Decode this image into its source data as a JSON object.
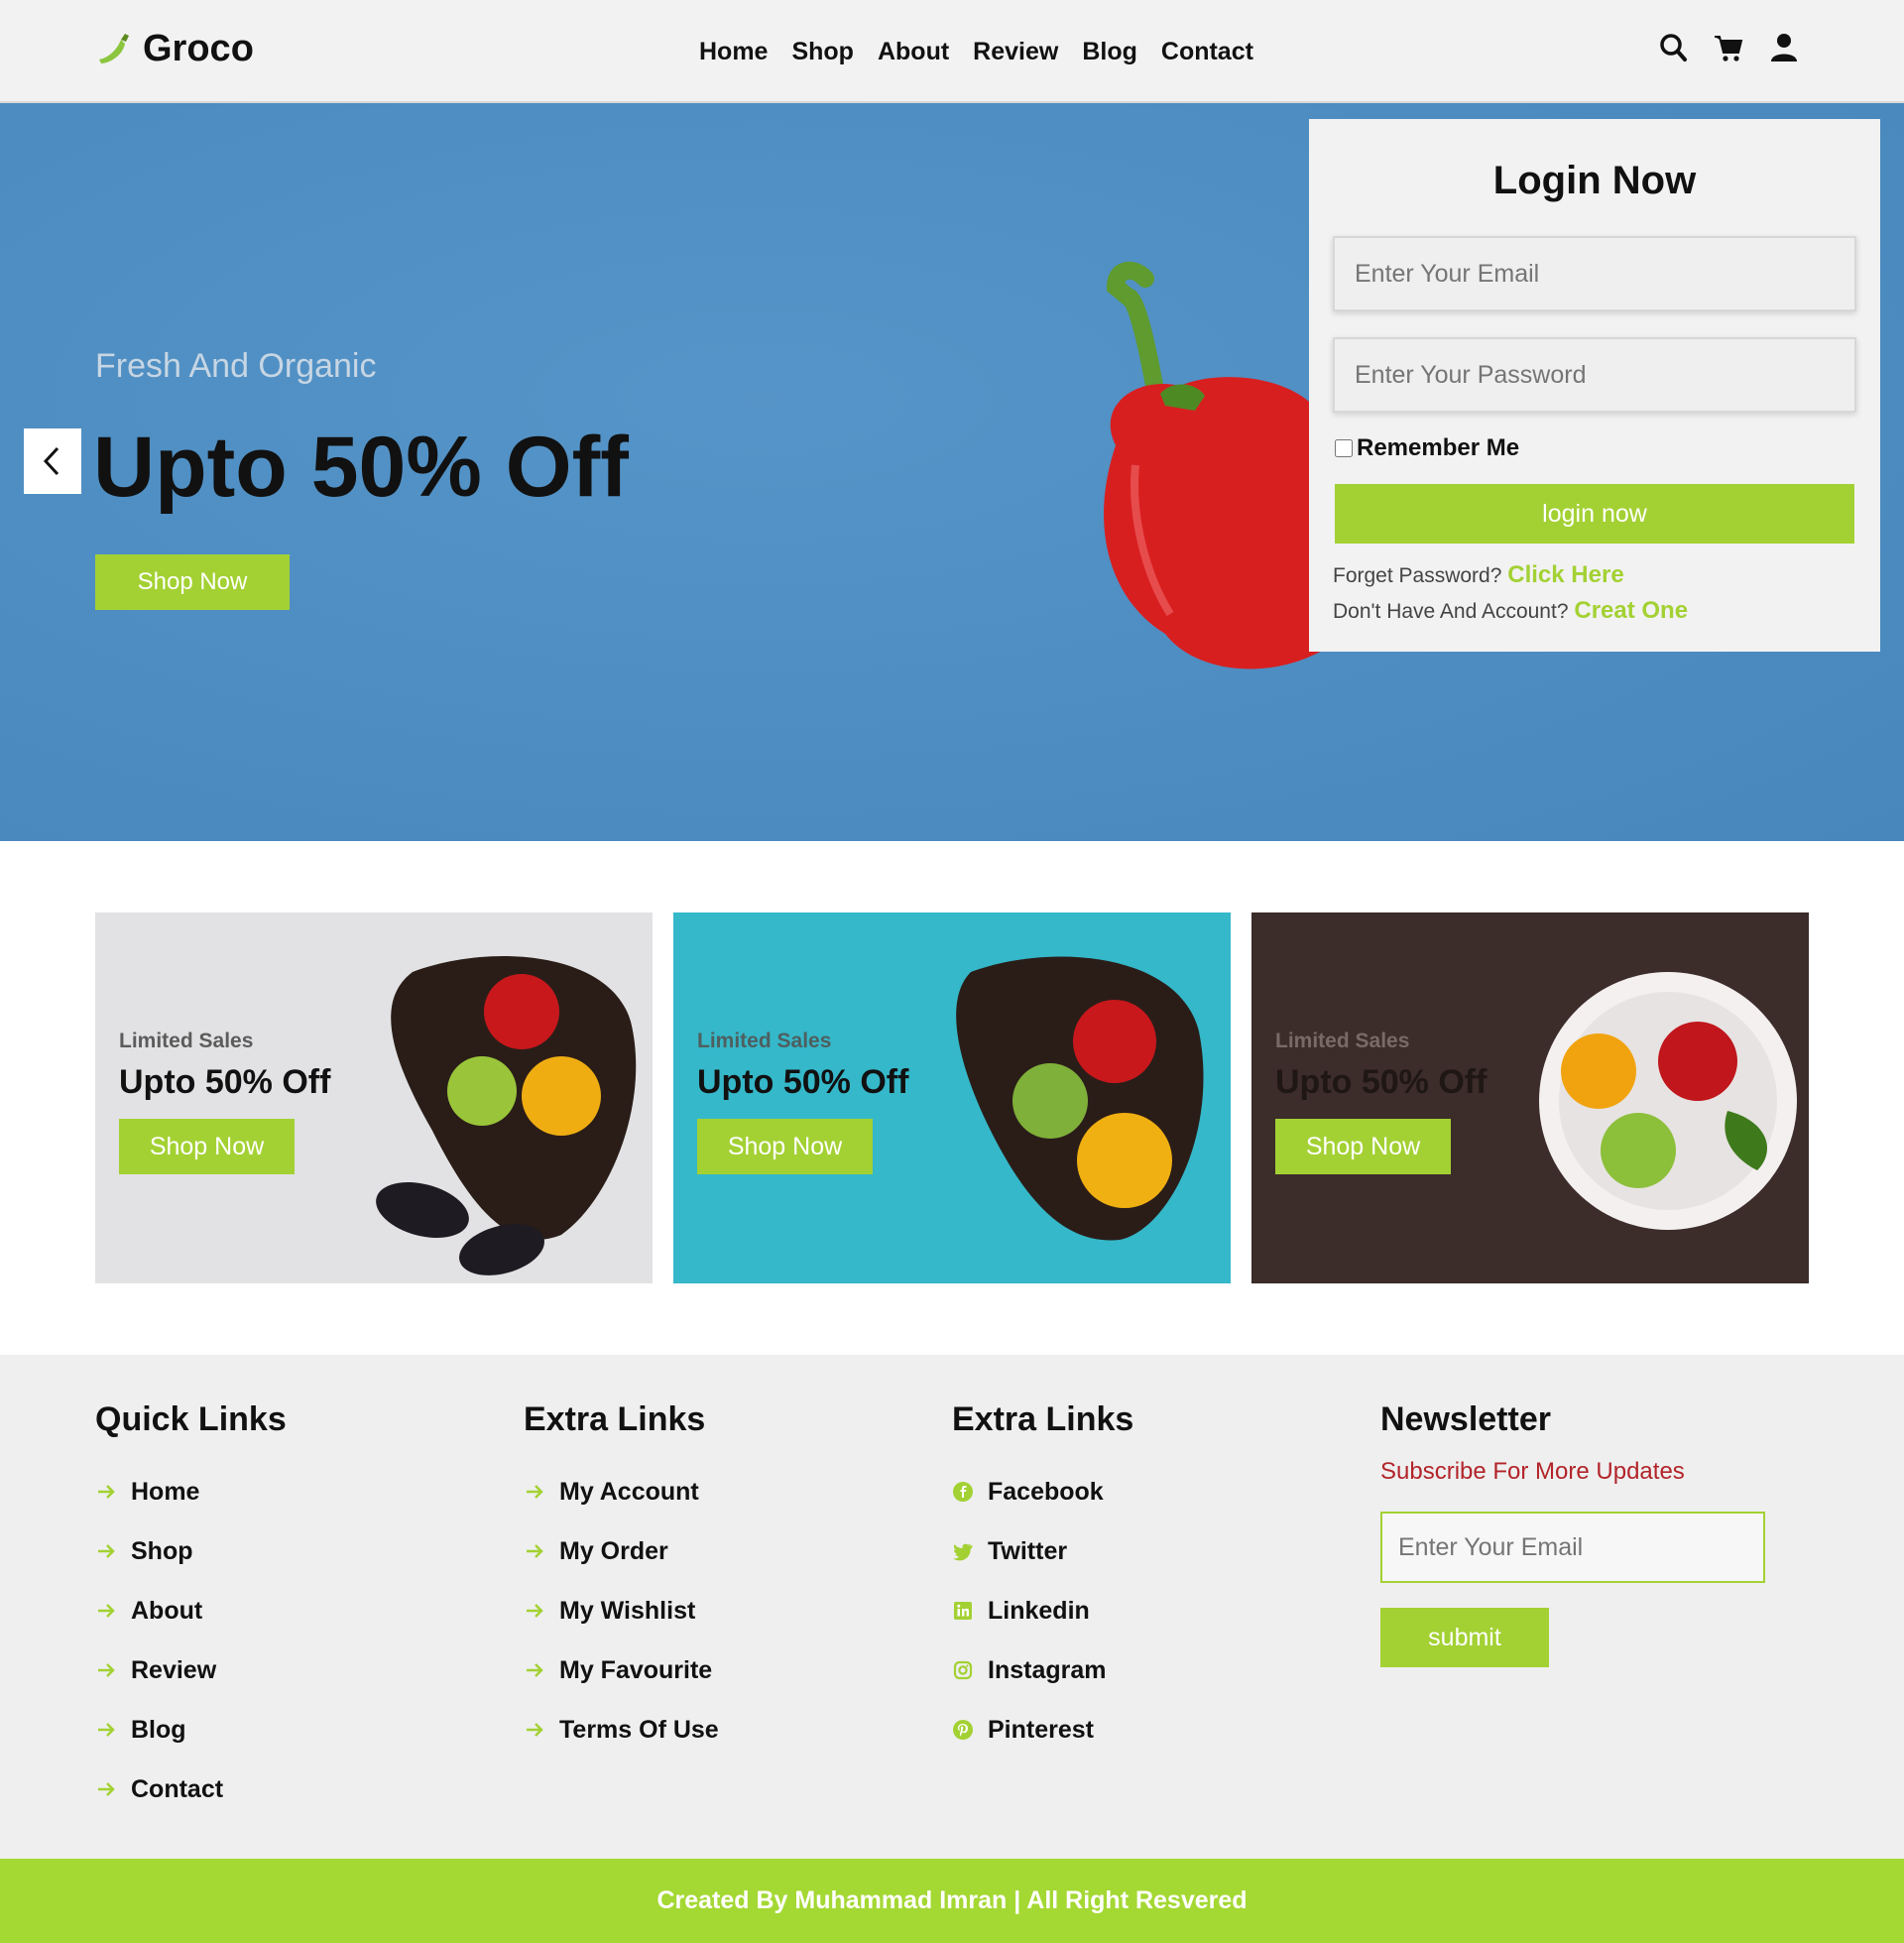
{
  "brand": {
    "name": "Groco",
    "accent": "#a3d133",
    "hero_bg": "#4b8ec5"
  },
  "nav": {
    "items": [
      "Home",
      "Shop",
      "About",
      "Review",
      "Blog",
      "Contact"
    ]
  },
  "header_icons": [
    "search-icon",
    "cart-icon",
    "user-icon"
  ],
  "hero": {
    "subtitle": "Fresh And Organic",
    "title": "Upto 50% Off",
    "button": "Shop Now"
  },
  "login": {
    "title": "Login Now",
    "email_placeholder": "Enter Your Email",
    "password_placeholder": "Enter Your Password",
    "remember": "Remember Me",
    "button": "login now",
    "forget_text": "Forget Password?",
    "forget_link": "Click Here",
    "account_text": "Don't Have And Account?",
    "account_link": "Creat One"
  },
  "cards": [
    {
      "label": "Limited Sales",
      "title": "Upto 50% Off",
      "button": "Shop Now"
    },
    {
      "label": "Limited Sales",
      "title": "Upto 50% Off",
      "button": "Shop Now"
    },
    {
      "label": "Limited Sales",
      "title": "Upto 50% Off",
      "button": "Shop Now"
    }
  ],
  "footer": {
    "quick": {
      "title": "Quick Links",
      "items": [
        "Home",
        "Shop",
        "About",
        "Review",
        "Blog",
        "Contact"
      ]
    },
    "extra": {
      "title": "Extra Links",
      "items": [
        "My Account",
        "My Order",
        "My Wishlist",
        "My Favourite",
        "Terms Of Use"
      ]
    },
    "social": {
      "title": "Extra Links",
      "items": [
        "Facebook",
        "Twitter",
        "Linkedin",
        "Instagram",
        "Pinterest"
      ]
    },
    "newsletter": {
      "title": "Newsletter",
      "subtitle": "Subscribe For More Updates",
      "placeholder": "Enter Your Email",
      "button": "submit"
    }
  },
  "copyright": "Created By Muhammad Imran | All Right Resvered"
}
